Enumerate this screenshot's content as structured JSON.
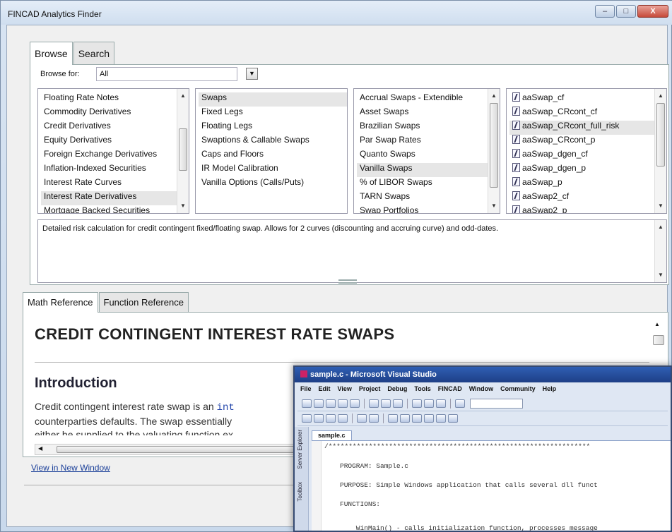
{
  "window": {
    "title": "FINCAD Analytics Finder",
    "controls": {
      "minimize": "–",
      "maximize": "□",
      "close": "X"
    }
  },
  "browse": {
    "tabs": [
      "Browse",
      "Search"
    ],
    "browse_for_label": "Browse for:",
    "browse_for_value": "All",
    "categories": [
      "Floating Rate Notes",
      "Commodity Derivatives",
      "Credit Derivatives",
      "Equity Derivatives",
      "Foreign Exchange Derivatives",
      "Inflation-Indexed Securities",
      "Interest Rate Curves",
      "Interest Rate Derivatives",
      "Mortgage Backed Securities"
    ],
    "subcategories": [
      "Swaps",
      "Fixed Legs",
      "Floating Legs",
      "Swaptions & Callable Swaps",
      "Caps and Floors",
      "IR Model Calibration",
      "Vanilla Options (Calls/Puts)"
    ],
    "swap_types": [
      "Accrual Swaps - Extendible",
      "Asset Swaps",
      "Brazilian Swaps",
      "Par Swap Rates",
      "Quanto Swaps",
      "Vanilla Swaps",
      "% of LIBOR Swaps",
      "TARN Swaps",
      "Swap Portfolios"
    ],
    "functions": [
      "aaSwap_cf",
      "aaSwap_CRcont_cf",
      "aaSwap_CRcont_full_risk",
      "aaSwap_CRcont_p",
      "aaSwap_dgen_cf",
      "aaSwap_dgen_p",
      "aaSwap_p",
      "aaSwap2_cf",
      "aaSwap2_p"
    ],
    "description": "Detailed risk calculation for credit contingent fixed/floating swap. Allows for 2 curves (discounting and accruing curve) and odd-dates."
  },
  "reference": {
    "tabs": [
      "Math Reference",
      "Function Reference"
    ],
    "title": "CREDIT CONTINGENT INTEREST RATE SWAPS",
    "heading": "Introduction",
    "line1_pre": "Credit contingent interest rate swap is an ",
    "line1_code": "int",
    "line2": "counterparties defaults. The swap essentially",
    "line3": "either be supplied to the valuating function ex",
    "view_link": "View in New Window"
  },
  "vs": {
    "title": "sample.c - Microsoft Visual Studio",
    "menu": [
      "File",
      "Edit",
      "View",
      "Project",
      "Debug",
      "Tools",
      "FINCAD",
      "Window",
      "Community",
      "Help"
    ],
    "doc_tab": "sample.c",
    "side_labels": [
      "Server Explorer",
      "Toolbox"
    ],
    "code_lines": [
      "/*****************************************************************",
      "PROGRAM: Sample.c",
      "PURPOSE: Simple Windows application that calls several dll funct",
      "FUNCTIONS:",
      "    WinMain() - calls initialization function, processes message"
    ]
  }
}
